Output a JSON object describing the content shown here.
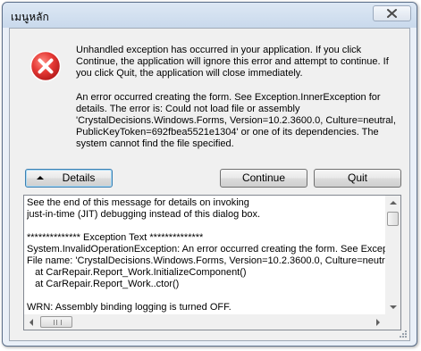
{
  "window": {
    "title": "เมนูหลัก"
  },
  "message": {
    "paragraph1": "Unhandled exception has occurred in your application. If you click\nContinue, the application will ignore this error and attempt to continue. If\nyou click Quit, the application will close immediately.",
    "paragraph2": "An error occurred creating the form. See Exception.InnerException for\ndetails.  The error is: Could not load file or assembly\n'CrystalDecisions.Windows.Forms, Version=10.2.3600.0, Culture=neutral,\nPublicKeyToken=692fbea5521e1304' or one of its dependencies. The\nsystem cannot find the file specified."
  },
  "buttons": {
    "details": "Details",
    "continue": "Continue",
    "quit": "Quit"
  },
  "details": {
    "lines": [
      "See the end of this message for details on invoking",
      "just-in-time (JIT) debugging instead of this dialog box.",
      "",
      "************** Exception Text **************",
      "System.InvalidOperationException: An error occurred creating the form. See Exceptio",
      "File name: 'CrystalDecisions.Windows.Forms, Version=10.2.3600.0, Culture=neutral, F",
      "   at CarRepair.Report_Work.InitializeComponent()",
      "   at CarRepair.Report_Work..ctor()",
      "",
      "WRN: Assembly binding logging is turned OFF."
    ]
  },
  "icons": {
    "error": "error-icon",
    "close": "close-icon"
  },
  "colors": {
    "error_red": "#d32f2f",
    "window_frame": "#eaf0f8"
  }
}
